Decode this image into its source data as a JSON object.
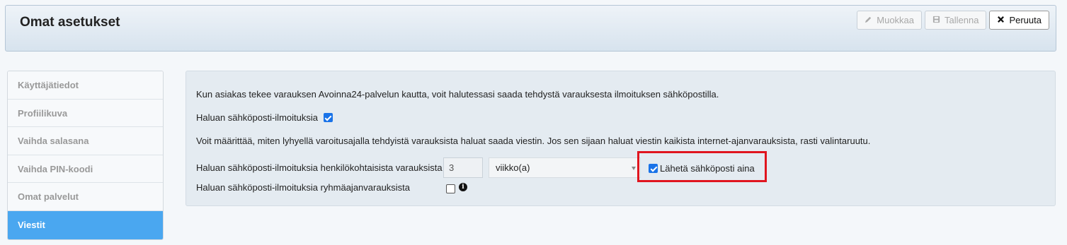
{
  "header": {
    "title": "Omat asetukset",
    "buttons": {
      "edit": "Muokkaa",
      "save": "Tallenna",
      "cancel": "Peruuta"
    }
  },
  "sidebar": {
    "items": [
      {
        "label": "Käyttäjätiedot"
      },
      {
        "label": "Profiilikuva"
      },
      {
        "label": "Vaihda salasana"
      },
      {
        "label": "Vaihda PIN-koodi"
      },
      {
        "label": "Omat palvelut"
      },
      {
        "label": "Viestit",
        "selected": true
      }
    ]
  },
  "main": {
    "intro": "Kun asiakas tekee varauksen Avoinna24-palvelun kautta, voit halutessasi saada tehdystä varauksesta ilmoituksen sähköpostilla.",
    "email_notifications_label": "Haluan sähköposti-ilmoituksia",
    "email_notifications_checked": true,
    "notice_text": "Voit määrittää, miten lyhyellä varoitusajalla tehdyistä varauksista haluat saada viestin. Jos sen sijaan haluat viestin kaikista internet-ajanvarauksista, rasti valintaruutu.",
    "personal_label": "Haluan sähköposti-ilmoituksia henkilökohtaisista varauksista",
    "personal_amount": "3",
    "personal_unit": "viikko(a)",
    "send_always_label": "Lähetä sähköposti aina",
    "send_always_checked": true,
    "group_label": "Haluan sähköposti-ilmoituksia ryhmäajanvarauksista",
    "group_checked": false
  },
  "colors": {
    "accent": "#4aa7f0",
    "highlight": "#e0151f",
    "checkbox": "#1a73e8"
  },
  "icons": [
    "pencil-icon",
    "floppy-disk-icon",
    "close-icon",
    "info-icon",
    "chevron-down-icon"
  ]
}
